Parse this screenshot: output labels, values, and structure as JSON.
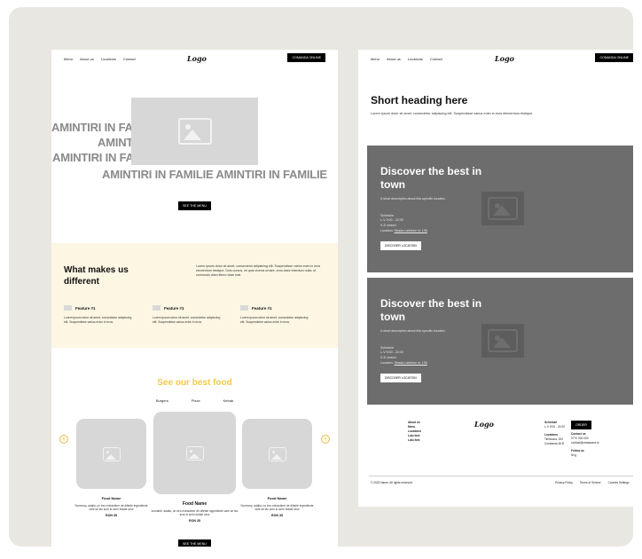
{
  "left_page": {
    "nav": {
      "links": [
        "Menu",
        "About us",
        "Locations",
        "Contact"
      ],
      "logo": "Logo",
      "cta": "COMANDA ONLINE"
    },
    "hero": {
      "lines": [
        "AMINTIRI IN FAMILIE",
        "AMINTIRI IN FAMILIE",
        "AMINTIRI IN FAMILIE",
        "AMINTIRI IN FAMILIE AMINTIRI IN FAMILIE"
      ],
      "button": "SEE THE MENU"
    },
    "different": {
      "title": "What makes us different",
      "text": "Lorem ipsum dolor sit amet, consectetur adipiscing elit. Suspendisse varius enim in eros elementum tristique. Duis cursus, mi quis viverra ornare, eros dolor interdum nulla, ut commodo diam libero vitae erat.",
      "features": [
        {
          "title": "Feature #1",
          "text": "Lorem ipsum dolor sit amet, consectetur adipiscing elit. Suspendisse varius enim in eros."
        },
        {
          "title": "Feature #1",
          "text": "Lorem ipsum dolor sit amet, consectetur adipiscing elit. Suspendisse varius enim in eros."
        },
        {
          "title": "Feature #1",
          "text": "Lorem ipsum dolor sit amet, consectetur adipiscing elit. Suspendisse varius enim in eros."
        }
      ]
    },
    "food": {
      "title": "See our best food",
      "tabs": [
        "Burgers",
        "Pizza",
        "Kebab"
      ],
      "arrow_prev": "‹",
      "arrow_next": "›",
      "cards": [
        {
          "name": "Food Name",
          "desc": "Somevoy, adalia, un inro extractiner de diferite ingrediente care se fac sure si scrin fodale ueor",
          "price": "RON 35"
        },
        {
          "name": "Food Name",
          "desc": "somable, adalia, un inro extractiner de diferite ingrediente care se fac sure si scrin fodale ueor",
          "price": "RON 35"
        },
        {
          "name": "Food Name",
          "desc": "Somevoy, adalia, un inro extractiner de diferite ingrediente care se fac sure si scrin fodale ueor",
          "price": "RON 35"
        }
      ],
      "button": "SEE THE MENU"
    },
    "colors": {
      "accent": "#f2c94c",
      "soft_bg": "#fdf6e3"
    }
  },
  "right_page": {
    "nav": {
      "links": [
        "Menu",
        "About us",
        "Locations",
        "Contact"
      ],
      "logo": "Logo",
      "cta": "COMANDA ONLINE"
    },
    "heading": "Short heading here",
    "subtext": "Lorem ipsum dolor sit amet, consectetur adipiscing elit. Suspendisse varius enim in eros elementum tristique.",
    "locations": [
      {
        "title": "Discover the best in town",
        "desc": "A short description about this specific location.",
        "schedule": [
          "Schedule",
          "L-V 9:00 - 22:00",
          "S-D closed"
        ],
        "location_label": "Location:",
        "location_link": "Strada Lalelelor nr. 195",
        "button": "DISCOVER LOCATION"
      },
      {
        "title": "Discover the best in town",
        "desc": "A short description about this specific location.",
        "schedule": [
          "Schedule",
          "L-V 9:00 - 22:00",
          "S-D closed"
        ],
        "location_label": "Location:",
        "location_link": "Strada Lalelelor nr. 195",
        "button": "DISCOVER LOCATION"
      }
    ],
    "footer": {
      "links": [
        "About us",
        "Menu",
        "Locations",
        "Lalu font",
        "Lalu font"
      ],
      "logo": "Logo",
      "schedule": [
        "Schedule",
        "L-V 9:00 - 22:00"
      ],
      "locations": [
        "Locations",
        "Timisoara, 200",
        "Constanta 36 B"
      ],
      "order_button": "ORDER",
      "contact": [
        "Contact us",
        "0770 000 000",
        "contact@restaurant.ro"
      ],
      "follow": [
        "Follow us",
        "fb ig"
      ],
      "copyright": "© 2023 Name. All rights reserved",
      "legal": [
        "Privacy Policy",
        "Terms of Service",
        "Cookies Settings"
      ]
    }
  }
}
